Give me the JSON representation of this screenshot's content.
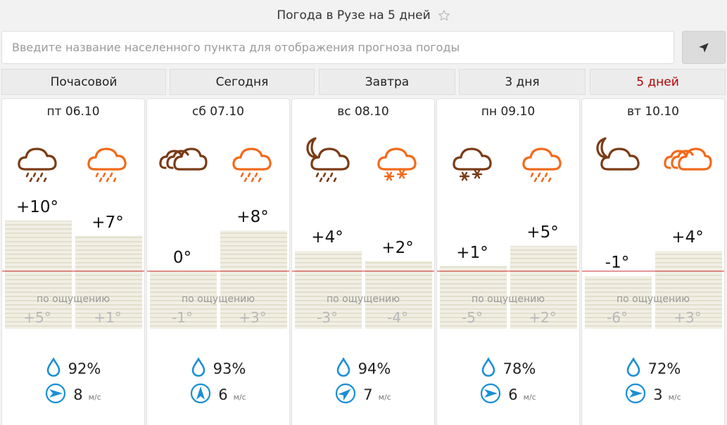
{
  "header": {
    "title": "Погода в Рузе на 5 дней"
  },
  "search": {
    "placeholder": "Введите название населенного пункта для отображения прогноза погоды"
  },
  "tabs": [
    {
      "label": "Почасовой",
      "active": false
    },
    {
      "label": "Сегодня",
      "active": false
    },
    {
      "label": "Завтра",
      "active": false
    },
    {
      "label": "3 дня",
      "active": false
    },
    {
      "label": "5 дней",
      "active": true
    }
  ],
  "feels_like_label": "по ощущению",
  "wind_unit": "м/с",
  "colors": {
    "day_icon": "#f26a1b",
    "night_icon": "#7a3b16",
    "active_tab": "#b00000",
    "zero_line": "#d22a2a"
  },
  "days": [
    {
      "date": "пт 06.10",
      "night_icon": "cloud-rain",
      "day_icon": "cloud-rain",
      "night_temp": 10,
      "day_temp": 7,
      "night_temp_label": "+10°",
      "day_temp_label": "+7°",
      "night_feel": 5,
      "day_feel": 1,
      "night_feel_label": "+5°",
      "day_feel_label": "+1°",
      "humidity": "92%",
      "wind_speed": "8",
      "wind_dir": "east"
    },
    {
      "date": "сб 07.10",
      "night_icon": "cloudy",
      "day_icon": "cloud-rain",
      "night_temp": 0,
      "day_temp": 8,
      "night_temp_label": "0°",
      "day_temp_label": "+8°",
      "night_feel": -1,
      "day_feel": 3,
      "night_feel_label": "-1°",
      "day_feel_label": "+3°",
      "humidity": "93%",
      "wind_speed": "6",
      "wind_dir": "north"
    },
    {
      "date": "вс 08.10",
      "night_icon": "moon-cloud-rain",
      "day_icon": "cloud-snow",
      "night_temp": 4,
      "day_temp": 2,
      "night_temp_label": "+4°",
      "day_temp_label": "+2°",
      "night_feel": -3,
      "day_feel": -4,
      "night_feel_label": "-3°",
      "day_feel_label": "-4°",
      "humidity": "94%",
      "wind_speed": "7",
      "wind_dir": "northeast"
    },
    {
      "date": "пн 09.10",
      "night_icon": "cloud-snow",
      "day_icon": "cloud-rain",
      "night_temp": 1,
      "day_temp": 5,
      "night_temp_label": "+1°",
      "day_temp_label": "+5°",
      "night_feel": -5,
      "day_feel": 2,
      "night_feel_label": "-5°",
      "day_feel_label": "+2°",
      "humidity": "78%",
      "wind_speed": "6",
      "wind_dir": "east"
    },
    {
      "date": "вт 10.10",
      "night_icon": "moon-cloudy",
      "day_icon": "cloudy",
      "night_temp": -1,
      "day_temp": 4,
      "night_temp_label": "-1°",
      "day_temp_label": "+4°",
      "night_feel": -6,
      "day_feel": 3,
      "night_feel_label": "-6°",
      "day_feel_label": "+3°",
      "humidity": "72%",
      "wind_speed": "3",
      "wind_dir": "east"
    }
  ]
}
